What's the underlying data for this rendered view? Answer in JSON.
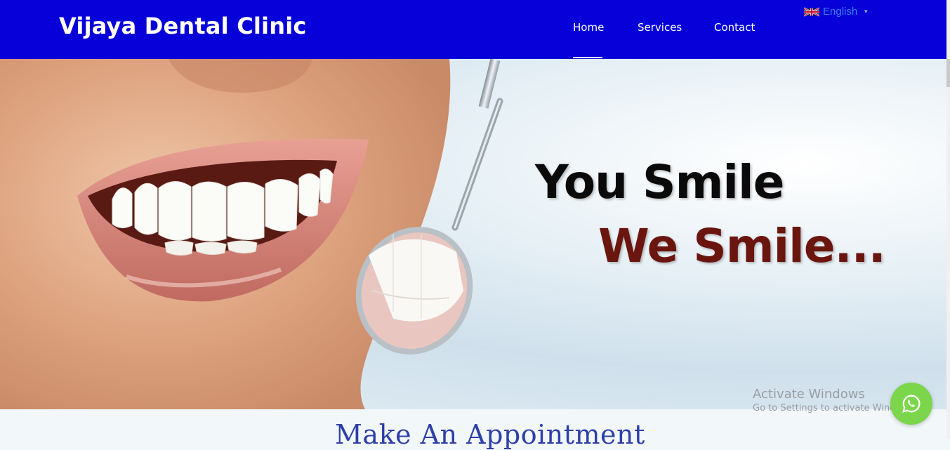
{
  "header": {
    "brand": "Vijaya Dental Clinic",
    "nav": {
      "home": "Home",
      "services": "Services",
      "contact": "Contact"
    },
    "language": {
      "selected": "English",
      "flag_icon": "uk-flag-icon"
    }
  },
  "hero": {
    "headline_line1": "You Smile",
    "headline_line2": "We Smile...",
    "image": "smiling-mouth-with-dental-mirror"
  },
  "overlay": {
    "activate_title": "Activate Windows",
    "activate_subtitle": "Go to Settings to activate Wind"
  },
  "appointment": {
    "title": "Make An Appointment"
  },
  "floating": {
    "whatsapp_icon": "whatsapp-icon"
  },
  "colors": {
    "header_bg": "#0700d9",
    "line2_color": "#6b150f",
    "whatsapp": "#7cd64c",
    "appointment_title": "#2e3fa8"
  }
}
